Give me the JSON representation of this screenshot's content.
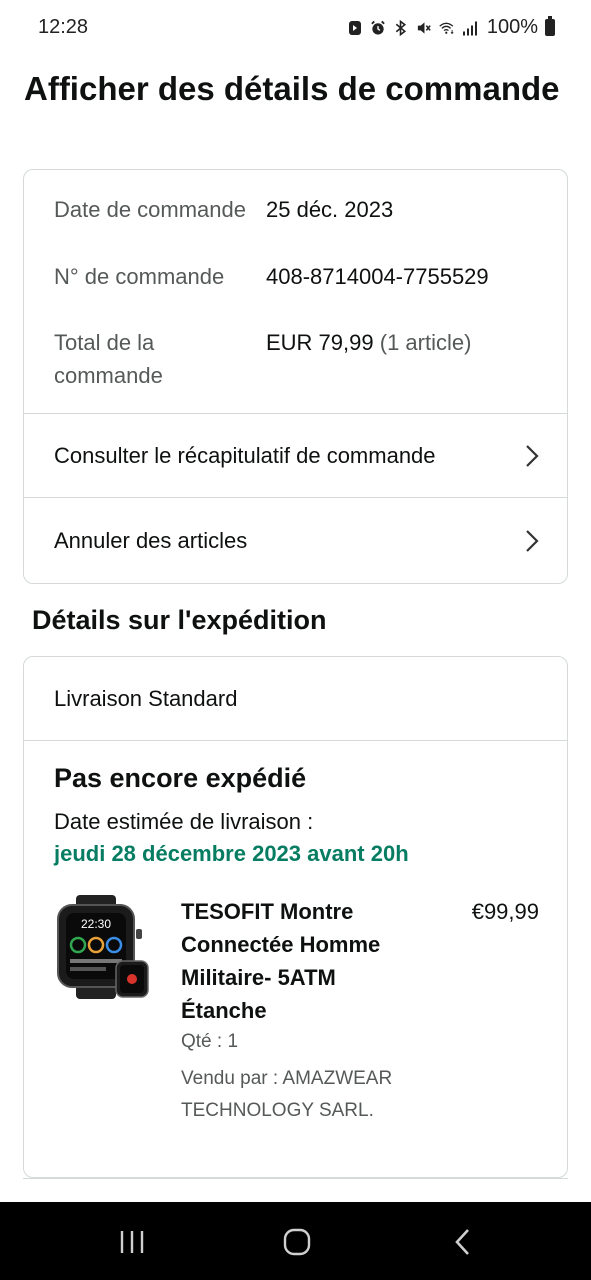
{
  "status_bar": {
    "time": "12:28",
    "battery": "100%",
    "icons": [
      "notification-icon",
      "alarm-icon",
      "bluetooth-icon",
      "mute-icon",
      "wifi-icon",
      "signal-icon",
      "battery-icon"
    ]
  },
  "page_title": "Afficher des détails de commande",
  "order_info": {
    "date_label": "Date de commande",
    "date_value": "25 déc. 2023",
    "number_label": "N° de commande",
    "number_value": "408-8714004-7755529",
    "total_label": "Total de la commande",
    "total_value": "EUR 79,99",
    "total_count": "(1 article)"
  },
  "links": {
    "summary": "Consulter le récapitulatif de commande",
    "cancel": "Annuler des articles"
  },
  "shipping": {
    "section_title": "Détails sur l'expédition",
    "method": "Livraison Standard",
    "status": "Pas encore expédié",
    "estimate_label": "Date estimée de livraison :",
    "estimate_date": "jeudi 28 décembre 2023 avant 20h"
  },
  "product": {
    "name": "TESOFIT Montre Connectée Homme Militaire- 5ATM Étanche",
    "price": "€99,99",
    "qty": "Qté : 1",
    "seller": "Vendu par : AMAZWEAR TECHNOLOGY SARL.",
    "watch_time": "22:30"
  },
  "colors": {
    "accent_green": "#067d62",
    "border": "#d5d9d9",
    "muted_text": "#565959"
  }
}
